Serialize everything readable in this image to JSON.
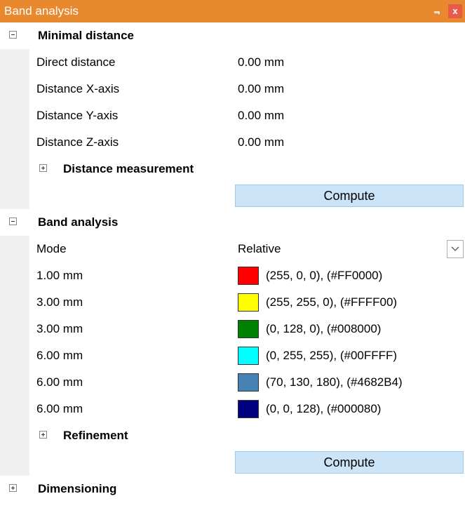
{
  "window": {
    "title": "Band analysis",
    "pin_glyph": "Ԃ",
    "close_glyph": "x"
  },
  "minimal_distance": {
    "label": "Minimal distance",
    "rows": [
      {
        "name": "Direct distance",
        "value": "0.00 mm"
      },
      {
        "name": "Distance X-axis",
        "value": "0.00 mm"
      },
      {
        "name": "Distance Y-axis",
        "value": "0.00 mm"
      },
      {
        "name": "Distance Z-axis",
        "value": "0.00 mm"
      }
    ],
    "distance_measurement_label": "Distance measurement",
    "compute_label": "Compute"
  },
  "band_analysis": {
    "label": "Band analysis",
    "mode_name": "Mode",
    "mode_value": "Relative",
    "bands": [
      {
        "distance": "1.00 mm",
        "color_text": "(255, 0, 0), (#FF0000)",
        "color": "#FF0000"
      },
      {
        "distance": "3.00 mm",
        "color_text": "(255, 255, 0), (#FFFF00)",
        "color": "#FFFF00"
      },
      {
        "distance": "3.00 mm",
        "color_text": "(0, 128, 0), (#008000)",
        "color": "#008000"
      },
      {
        "distance": "6.00 mm",
        "color_text": "(0, 255, 255), (#00FFFF)",
        "color": "#00FFFF"
      },
      {
        "distance": "6.00 mm",
        "color_text": "(70, 130, 180), (#4682B4)",
        "color": "#4682B4"
      },
      {
        "distance": "6.00 mm",
        "color_text": "(0, 0, 128), (#000080)",
        "color": "#000080"
      }
    ],
    "refinement_label": "Refinement",
    "compute_label": "Compute"
  },
  "dimensioning": {
    "label": "Dimensioning"
  },
  "colors": {
    "titlebar": "#e8892f",
    "compute_bg": "#cce4f7"
  }
}
